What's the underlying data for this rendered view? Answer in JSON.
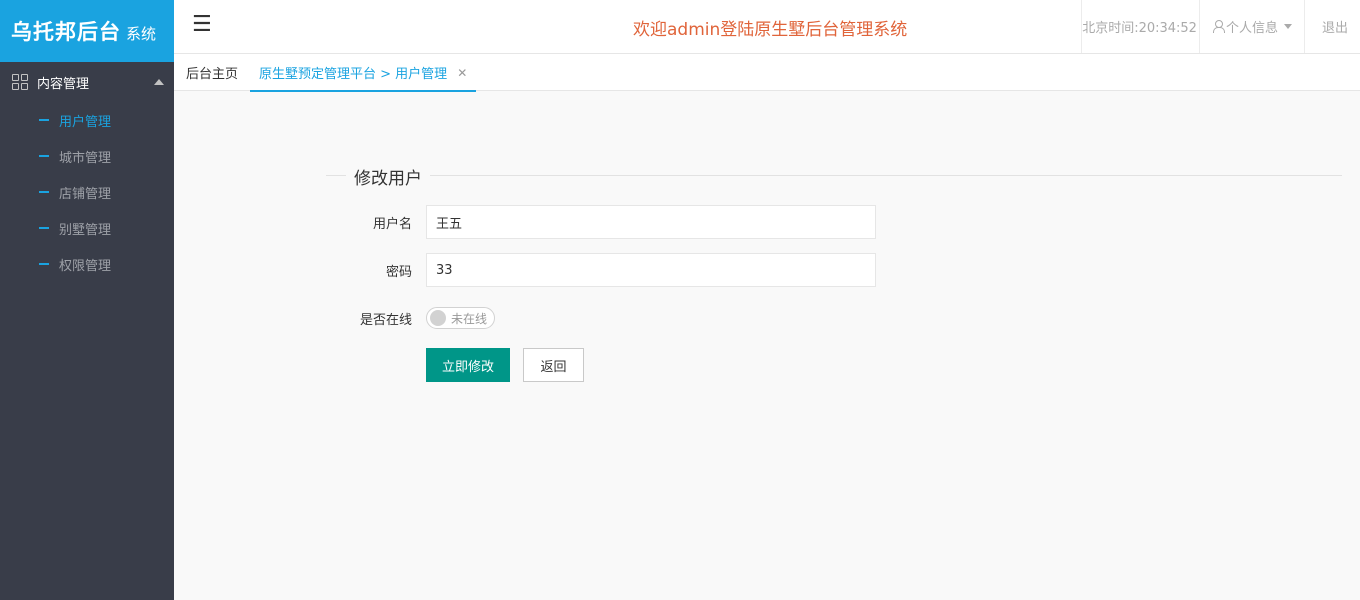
{
  "app": {
    "logo_main": "乌托邦后台",
    "logo_sub": "系统"
  },
  "header": {
    "menu_icon": "hamburger-icon",
    "welcome": "欢迎admin登陆原生墅后台管理系统",
    "time_text": "北京时间:20:34:52",
    "user_label": "个人信息",
    "logout_label": "退出",
    "welcome_color": "#e0643a"
  },
  "sidebar": {
    "group_label": "内容管理",
    "items": [
      {
        "label": "用户管理",
        "active": true
      },
      {
        "label": "城市管理",
        "active": false
      },
      {
        "label": "店铺管理",
        "active": false
      },
      {
        "label": "别墅管理",
        "active": false
      },
      {
        "label": "权限管理",
        "active": false
      }
    ],
    "accent_color": "#1aa3e0"
  },
  "tabs": [
    {
      "label": "后台主页",
      "active": false
    },
    {
      "label": "原生墅预定管理平台 > 用户管理",
      "active": true,
      "closable": true
    }
  ],
  "form": {
    "title": "修改用户",
    "username_label": "用户名",
    "username_value": "王五",
    "password_label": "密码",
    "password_value": "33",
    "online_label": "是否在线",
    "online_switch_text": "未在线",
    "online": false,
    "submit_label": "立即修改",
    "back_label": "返回",
    "submit_color": "#009688"
  }
}
